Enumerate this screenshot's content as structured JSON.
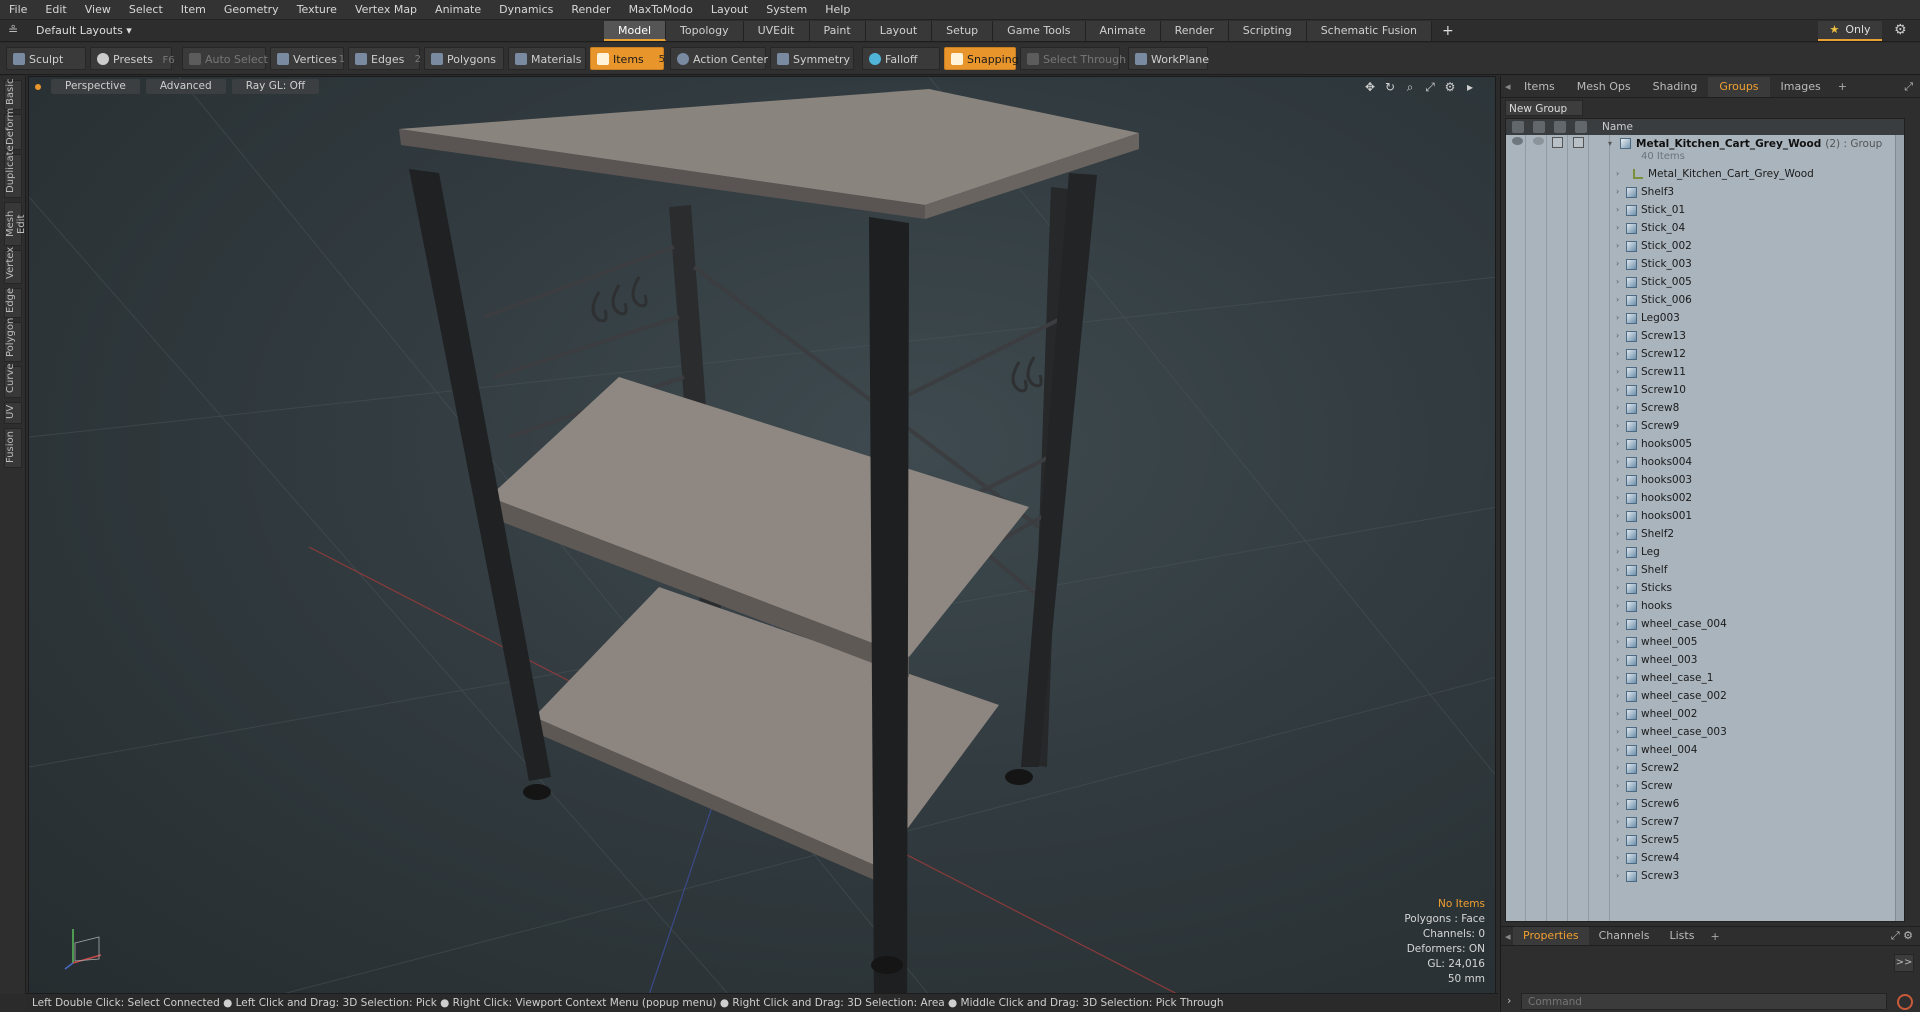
{
  "menu": [
    "File",
    "Edit",
    "View",
    "Select",
    "Item",
    "Geometry",
    "Texture",
    "Vertex Map",
    "Animate",
    "Dynamics",
    "Render",
    "MaxToModo",
    "Layout",
    "System",
    "Help"
  ],
  "layout_dropdown": "Default Layouts ▾",
  "mode_tabs": [
    {
      "label": "Model",
      "active": true
    },
    {
      "label": "Topology",
      "active": false
    },
    {
      "label": "UVEdit",
      "active": false
    },
    {
      "label": "Paint",
      "active": false
    },
    {
      "label": "Layout",
      "active": false
    },
    {
      "label": "Setup",
      "active": false
    },
    {
      "label": "Game Tools",
      "active": false
    },
    {
      "label": "Animate",
      "active": false
    },
    {
      "label": "Render",
      "active": false
    },
    {
      "label": "Scripting",
      "active": false
    },
    {
      "label": "Schematic Fusion",
      "active": false
    }
  ],
  "mode_tabs_plus": "+",
  "only_button": "Only",
  "toolbar": {
    "sculpt": "Sculpt",
    "presets": "Presets",
    "presets_key": "F6",
    "auto_select": "Auto Select",
    "vertices": "Vertices",
    "vertices_count": "1",
    "edges": "Edges",
    "edges_count": "2",
    "polygons": "Polygons",
    "materials": "Materials",
    "items": "Items",
    "items_count": "5",
    "action_center": "Action Center",
    "symmetry": "Symmetry",
    "falloff": "Falloff",
    "snapping": "Snapping",
    "select_through": "Select Through",
    "workplane": "WorkPlane"
  },
  "left_tabs": [
    "Basic",
    "Deform",
    "Duplicate",
    "Mesh Edit",
    "Vertex",
    "Edge",
    "Polygon",
    "Curve",
    "UV",
    "Fusion"
  ],
  "viewport": {
    "view": "Perspective",
    "shading": "Advanced",
    "raygl": "Ray GL: Off",
    "info": {
      "no_items": "No Items",
      "polygons": "Polygons : Face",
      "channels": "Channels: 0",
      "deformers": "Deformers: ON",
      "gl": "GL: 24,016",
      "scale": "50 mm"
    }
  },
  "status_bar": "Left Double Click: Select Connected ● Left Click and Drag: 3D Selection: Pick ● Right Click: Viewport Context Menu (popup menu) ● Right Click and Drag: 3D Selection: Area ● Middle Click and Drag: 3D Selection: Pick Through",
  "right_panel": {
    "tabs": [
      {
        "label": "Items",
        "active": false
      },
      {
        "label": "Mesh Ops",
        "active": false
      },
      {
        "label": "Shading",
        "active": false
      },
      {
        "label": "Groups",
        "active": true
      },
      {
        "label": "Images",
        "active": false
      }
    ],
    "tabs_plus": "+",
    "new_group": "New Group",
    "list_header_name": "Name",
    "group": {
      "name": "Metal_Kitchen_Cart_Grey_Wood",
      "type": "(2) : Group",
      "count": "40 Items"
    },
    "items": [
      "Metal_Kitchen_Cart_Grey_Wood",
      "Shelf3",
      "Stick_01",
      "Stick_04",
      "Stick_002",
      "Stick_003",
      "Stick_005",
      "Stick_006",
      "Leg003",
      "Screw13",
      "Screw12",
      "Screw11",
      "Screw10",
      "Screw8",
      "Screw9",
      "hooks005",
      "hooks004",
      "hooks003",
      "hooks002",
      "hooks001",
      "Shelf2",
      "Leg",
      "Shelf",
      "Sticks",
      "hooks",
      "wheel_case_004",
      "wheel_005",
      "wheel_003",
      "wheel_case_1",
      "wheel_case_002",
      "wheel_002",
      "wheel_case_003",
      "wheel_004",
      "Screw2",
      "Screw",
      "Screw6",
      "Screw7",
      "Screw5",
      "Screw4",
      "Screw3"
    ],
    "bottom_tabs": [
      {
        "label": "Properties",
        "active": true
      },
      {
        "label": "Channels",
        "active": false
      },
      {
        "label": "Lists",
        "active": false
      }
    ],
    "bottom_tabs_plus": "+",
    "expand": ">>",
    "command_placeholder": "Command"
  },
  "colors": {
    "accent": "#e8952c",
    "list_bg": "#a9b4bd"
  }
}
